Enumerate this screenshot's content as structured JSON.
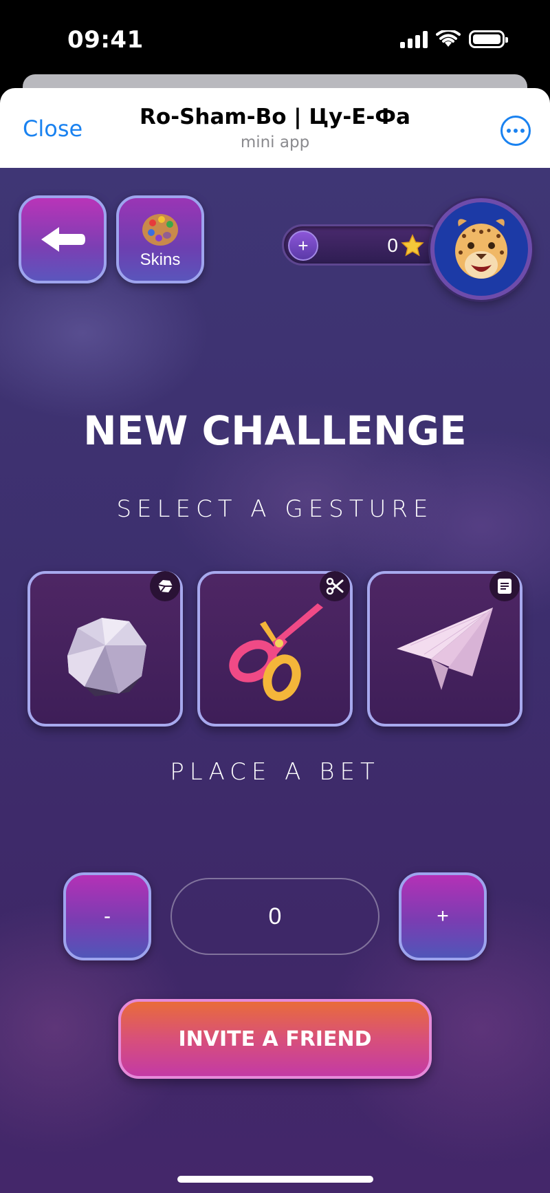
{
  "status_bar": {
    "time": "09:41"
  },
  "header": {
    "close_label": "Close",
    "title": "Ro-Sham-Bo | Цу-Е-Фа",
    "subtitle": "mini app"
  },
  "toolbar": {
    "back_icon": "arrow-left-icon",
    "skins_label": "Skins",
    "skins_icon": "palette-icon"
  },
  "balance": {
    "plus_label": "+",
    "value": "0",
    "currency_icon": "star-icon"
  },
  "main": {
    "title": "NEW CHALLENGE",
    "gesture_prompt": "SELECT A GESTURE",
    "gestures": [
      {
        "name": "rock",
        "badge_icon": "rock-icon"
      },
      {
        "name": "scissors",
        "badge_icon": "scissors-icon"
      },
      {
        "name": "paper",
        "badge_icon": "paper-icon"
      }
    ],
    "bet_prompt": "PLACE A BET"
  },
  "bet": {
    "minus_label": "-",
    "value": "0",
    "plus_label": "+"
  },
  "invite_label": "INVITE A FRIEND",
  "colors": {
    "accent_blue": "#1a82f0",
    "button_magenta": "#b934b8",
    "button_border": "#9ea4ee",
    "invite_orange": "#e96c3a",
    "invite_pink": "#c33aa5",
    "background": "#3e2e6e"
  }
}
